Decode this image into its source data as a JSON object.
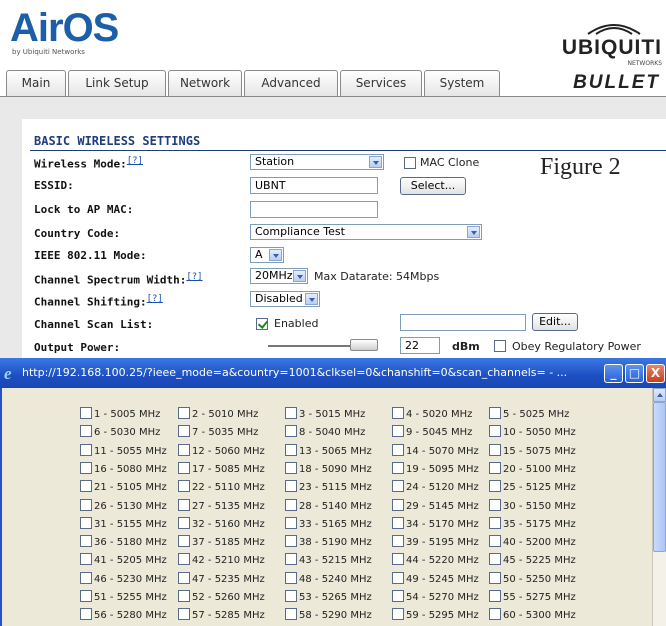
{
  "header": {
    "brand": "AirOS",
    "brand_sub": "by Ubiquiti Networks",
    "company": "UBIQUITI",
    "company_sub": "NETWORKS",
    "product": "BULLET"
  },
  "tabs": [
    {
      "label": "Main"
    },
    {
      "label": "Link Setup"
    },
    {
      "label": "Network"
    },
    {
      "label": "Advanced"
    },
    {
      "label": "Services"
    },
    {
      "label": "System"
    }
  ],
  "section": {
    "title": "BASIC WIRELESS SETTINGS",
    "figure_label": "Figure 2"
  },
  "form": {
    "wireless_mode_label": "Wireless Mode:",
    "wireless_mode_value": "Station",
    "mac_clone_label": "MAC Clone",
    "essid_label": "ESSID:",
    "essid_value": "UBNT",
    "select_button": "Select...",
    "lock_ap_label": "Lock to AP MAC:",
    "lock_ap_value": "",
    "country_label": "Country Code:",
    "country_value": "Compliance Test",
    "ieee_label": "IEEE 802.11 Mode:",
    "ieee_value": "A",
    "spectrum_label": "Channel Spectrum Width:",
    "spectrum_value": "20MHz",
    "max_datarate": "Max Datarate: 54Mbps",
    "shifting_label": "Channel Shifting:",
    "shifting_value": "Disabled",
    "scan_list_label": "Channel Scan List:",
    "scan_enabled_label": "Enabled",
    "scan_enabled_checked": true,
    "scan_list_value": "",
    "edit_button": "Edit...",
    "output_power_label": "Output Power:",
    "output_power_value": "22",
    "output_power_unit": "dBm",
    "obey_label": "Obey Regulatory Power",
    "help_marker": "[?]"
  },
  "popup": {
    "url": "http://192.168.100.25/?ieee_mode=a&country=1001&clksel=0&chanshift=0&scan_channels= - ...",
    "minimize": "_",
    "maximize": "□",
    "close": "X",
    "channels": [
      "1 - 5005 MHz",
      "2 - 5010 MHz",
      "3 - 5015 MHz",
      "4 - 5020 MHz",
      "5 - 5025 MHz",
      "6 - 5030 MHz",
      "7 - 5035 MHz",
      "8 - 5040 MHz",
      "9 - 5045 MHz",
      "10 - 5050 MHz",
      "11 - 5055 MHz",
      "12 - 5060 MHz",
      "13 - 5065 MHz",
      "14 - 5070 MHz",
      "15 - 5075 MHz",
      "16 - 5080 MHz",
      "17 - 5085 MHz",
      "18 - 5090 MHz",
      "19 - 5095 MHz",
      "20 - 5100 MHz",
      "21 - 5105 MHz",
      "22 - 5110 MHz",
      "23 - 5115 MHz",
      "24 - 5120 MHz",
      "25 - 5125 MHz",
      "26 - 5130 MHz",
      "27 - 5135 MHz",
      "28 - 5140 MHz",
      "29 - 5145 MHz",
      "30 - 5150 MHz",
      "31 - 5155 MHz",
      "32 - 5160 MHz",
      "33 - 5165 MHz",
      "34 - 5170 MHz",
      "35 - 5175 MHz",
      "36 - 5180 MHz",
      "37 - 5185 MHz",
      "38 - 5190 MHz",
      "39 - 5195 MHz",
      "40 - 5200 MHz",
      "41 - 5205 MHz",
      "42 - 5210 MHz",
      "43 - 5215 MHz",
      "44 - 5220 MHz",
      "45 - 5225 MHz",
      "46 - 5230 MHz",
      "47 - 5235 MHz",
      "48 - 5240 MHz",
      "49 - 5245 MHz",
      "50 - 5250 MHz",
      "51 - 5255 MHz",
      "52 - 5260 MHz",
      "53 - 5265 MHz",
      "54 - 5270 MHz",
      "55 - 5275 MHz",
      "56 - 5280 MHz",
      "57 - 5285 MHz",
      "58 - 5290 MHz",
      "59 - 5295 MHz",
      "60 - 5300 MHz"
    ]
  }
}
